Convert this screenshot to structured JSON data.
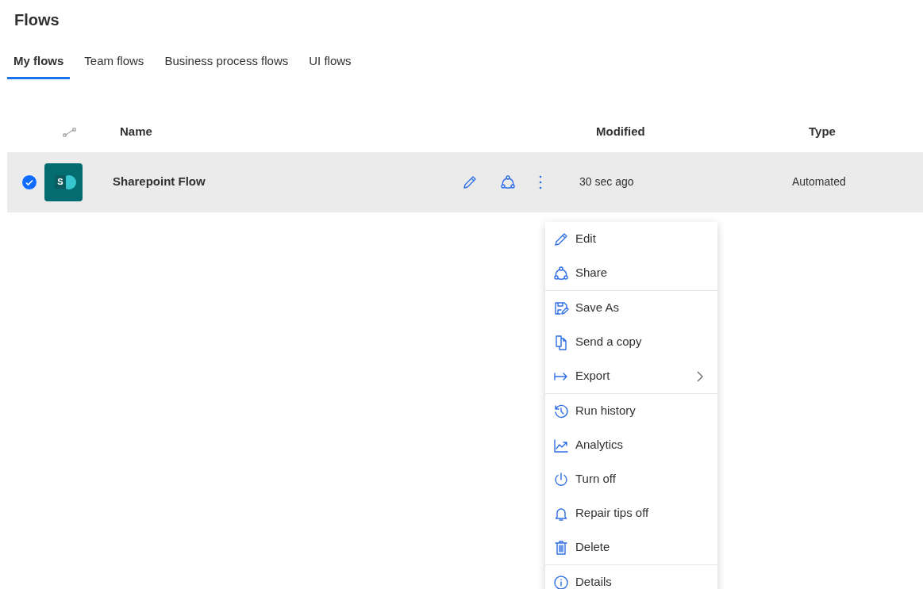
{
  "page": {
    "title": "Flows"
  },
  "tabs": [
    {
      "label": "My flows",
      "selected": true
    },
    {
      "label": "Team flows",
      "selected": false
    },
    {
      "label": "Business process flows",
      "selected": false
    },
    {
      "label": "UI flows",
      "selected": false
    }
  ],
  "table": {
    "columns": [
      "Name",
      "Modified",
      "Type"
    ],
    "rows": [
      {
        "selected": true,
        "logo_letter": "S",
        "name": "Sharepoint Flow",
        "modified": "30 sec ago",
        "type": "Automated"
      }
    ]
  },
  "context_menu": {
    "groups": [
      [
        {
          "label": "Edit",
          "submenu": false
        },
        {
          "label": "Share",
          "submenu": false
        }
      ],
      [
        {
          "label": "Save As",
          "submenu": false
        },
        {
          "label": "Send a copy",
          "submenu": false
        },
        {
          "label": "Export",
          "submenu": true
        }
      ],
      [
        {
          "label": "Run history",
          "submenu": false
        },
        {
          "label": "Analytics",
          "submenu": false
        },
        {
          "label": "Turn off",
          "submenu": false
        },
        {
          "label": "Repair tips off",
          "submenu": false
        },
        {
          "label": "Delete",
          "submenu": false
        }
      ],
      [
        {
          "label": "Details",
          "submenu": false
        }
      ]
    ]
  }
}
